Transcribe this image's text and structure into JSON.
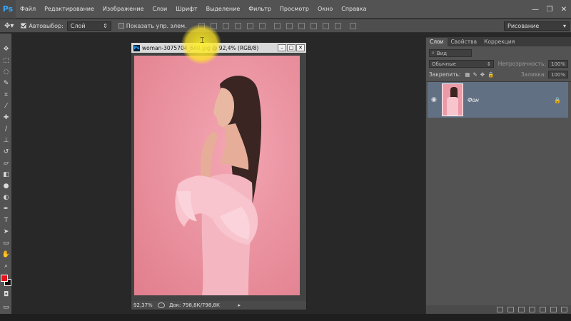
{
  "app": {
    "logo": "Ps"
  },
  "menu": [
    "Файл",
    "Редактирование",
    "Изображение",
    "Слои",
    "Шрифт",
    "Выделение",
    "Фильтр",
    "Просмотр",
    "Окно",
    "Справка"
  ],
  "window_controls": {
    "minimize": "—",
    "restore": "❐",
    "close": "✕"
  },
  "options": {
    "autoselect_label": "Автовыбор:",
    "autoselect_value": "Слой",
    "show_controls_label": "Показать упр. элем.",
    "workspace": "Рисование"
  },
  "document": {
    "title": "woman-3075704_640.jpg @ 92,4% (RGB/8)",
    "zoom": "92,37%",
    "doc_info": "Док: 798,8К/798,8К"
  },
  "panel": {
    "tabs": [
      "Слои",
      "Свойства",
      "Коррекция"
    ],
    "filter_label": "Вид",
    "blend_mode": "Обычные",
    "opacity_label": "Непрозрачность:",
    "opacity_value": "100%",
    "lock_label": "Закрепить:",
    "fill_label": "Заливка:",
    "fill_value": "100%",
    "layer_name": "Фон"
  },
  "colors": {
    "accent": "#31a8ff",
    "foreground": "#e8101a",
    "background": "#111111",
    "canvas_bg": "#ec9aa7",
    "layer_selected": "#627084"
  }
}
